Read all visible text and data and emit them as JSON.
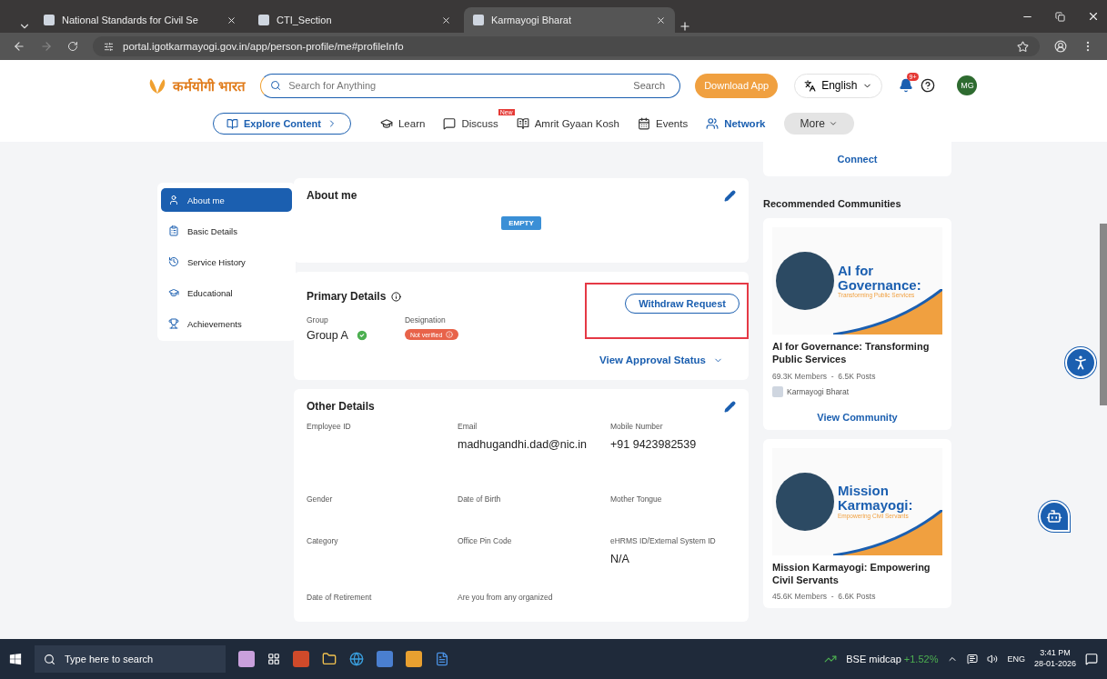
{
  "browser": {
    "tabs": [
      {
        "title": "National Standards for Civil Se",
        "selected": false
      },
      {
        "title": "CTI_Section",
        "selected": false
      },
      {
        "title": "Karmayogi Bharat",
        "selected": true
      }
    ],
    "url": "portal.igotkarmayogi.gov.in/app/person-profile/me#profileInfo"
  },
  "header": {
    "logo": "कर्मयोगी भारत",
    "search_placeholder": "Search for Anything",
    "search_button": "Search",
    "download": "Download App",
    "language": "English",
    "notifications": "9+",
    "avatar": "MG"
  },
  "nav": {
    "explore": "Explore Content",
    "items": [
      {
        "label": "Learn",
        "kind": "learn"
      },
      {
        "label": "Discuss",
        "kind": "discuss",
        "badge": "New"
      },
      {
        "label": "Amrit Gyaan Kosh",
        "kind": "book"
      },
      {
        "label": "Events",
        "kind": "events"
      },
      {
        "label": "Network",
        "kind": "network"
      }
    ],
    "more": "More"
  },
  "sidebar": {
    "items": [
      {
        "label": "About me",
        "kind": "user",
        "selected": true
      },
      {
        "label": "Basic Details",
        "kind": "details",
        "selected": false
      },
      {
        "label": "Service History",
        "kind": "history",
        "selected": false
      },
      {
        "label": "Educational",
        "kind": "education",
        "selected": false
      },
      {
        "label": "Achievements",
        "kind": "trophy",
        "selected": false
      }
    ]
  },
  "about_me": {
    "title": "About me",
    "empty": "EMPTY"
  },
  "primary_details": {
    "title": "Primary Details",
    "action": "Withdraw Request",
    "fields": [
      {
        "label": "Group",
        "value": "Group A",
        "verified": true
      },
      {
        "label": "Designation",
        "value": "Not verified",
        "verified": false
      }
    ],
    "approval": "View Approval Status"
  },
  "other_details": {
    "title": "Other Details",
    "fields": [
      {
        "label": "Employee ID"
      },
      {
        "label": "Email",
        "value": "madhugandhi.dad@nic.in"
      },
      {
        "label": "Mobile Number",
        "value": "+91 9423982539"
      },
      {
        "label": "Gender"
      },
      {
        "label": "Date of Birth"
      },
      {
        "label": "Mother Tongue"
      },
      {
        "label": "Category"
      },
      {
        "label": "Office Pin Code"
      },
      {
        "label": "eHRMS ID/External System ID",
        "value": "N/A"
      },
      {
        "label": "Date of Retirement"
      },
      {
        "label": "Are you from any organized"
      }
    ]
  },
  "right": {
    "connect": "Connect",
    "title": "Recommended Communities",
    "communities": [
      {
        "banner_title": "AI for Governance:",
        "banner_subtitle": "Transforming Public Services",
        "name": "AI for Governance: Transforming Public Services",
        "members": "69.3K Members",
        "separator": "-",
        "posts": "6.5K Posts",
        "provider": "Karmayogi Bharat",
        "action": "View Community"
      },
      {
        "banner_title": "Mission Karmayogi:",
        "banner_subtitle": "Empowering Civil Servants",
        "name": "Mission Karmayogi: Empowering Civil Servants",
        "members": "45.6K Members",
        "separator": "-",
        "posts": "6.6K Posts"
      }
    ]
  },
  "taskbar": {
    "search_placeholder": "Type here to search",
    "stock": "BSE midcap",
    "change": "+1.52%",
    "language": "ENG",
    "time": "3:41 PM",
    "date": "28-01-2026"
  }
}
